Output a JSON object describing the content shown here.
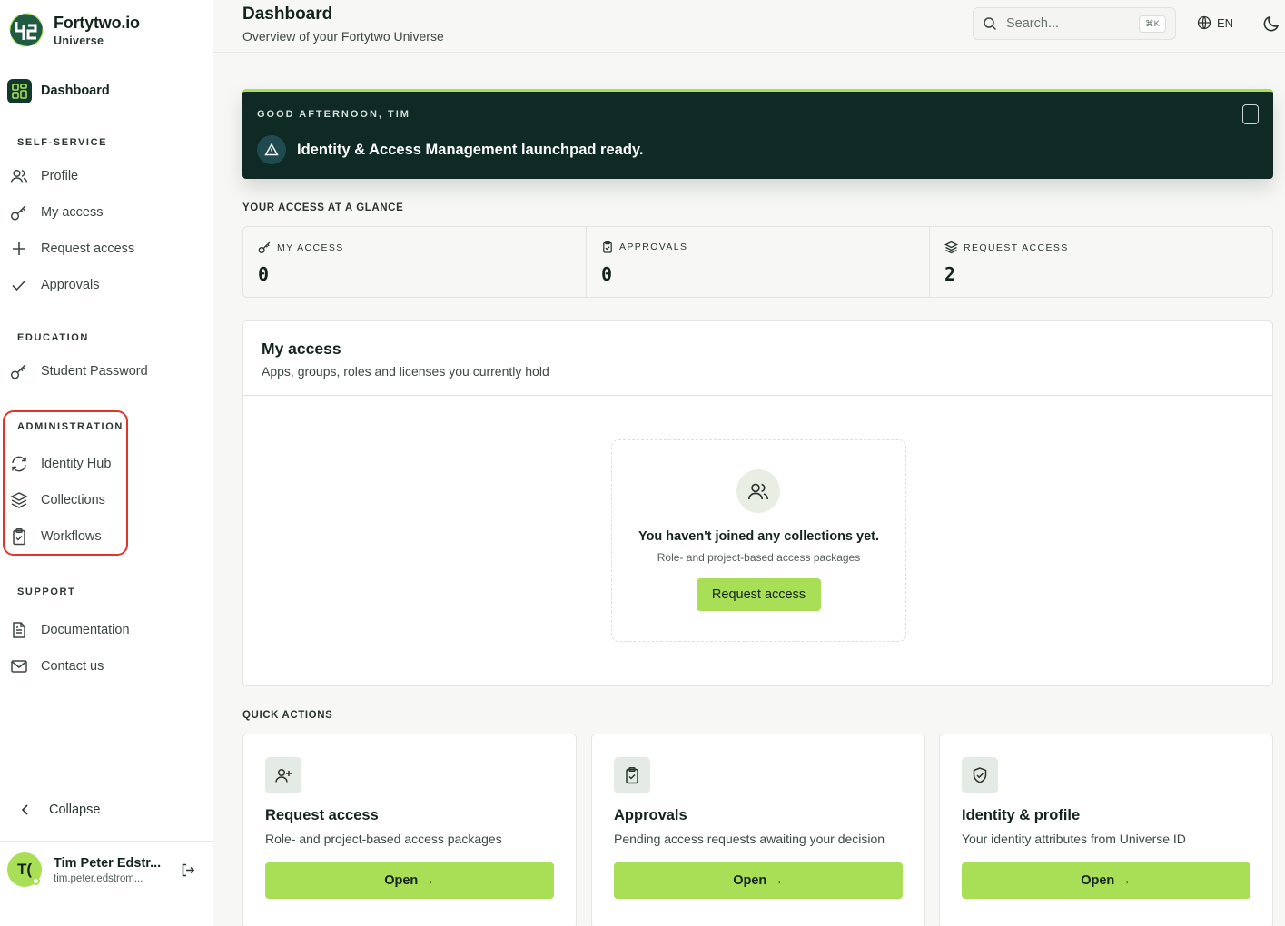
{
  "brand": {
    "name": "Fortytwo.io",
    "subtitle": "Universe"
  },
  "sidebar": {
    "dashboard_label": "Dashboard",
    "sections": [
      {
        "label": "SELF-SERVICE",
        "items": [
          {
            "label": "Profile",
            "icon": "users-icon"
          },
          {
            "label": "My access",
            "icon": "key-icon"
          },
          {
            "label": "Request access",
            "icon": "plus-icon"
          },
          {
            "label": "Approvals",
            "icon": "check-icon"
          }
        ]
      },
      {
        "label": "EDUCATION",
        "items": [
          {
            "label": "Student Password",
            "icon": "key-icon"
          }
        ]
      },
      {
        "label": "ADMINISTRATION",
        "items": [
          {
            "label": "Identity Hub",
            "icon": "refresh-icon"
          },
          {
            "label": "Collections",
            "icon": "layers-icon"
          },
          {
            "label": "Workflows",
            "icon": "clipboard-check-icon"
          }
        ]
      },
      {
        "label": "SUPPORT",
        "items": [
          {
            "label": "Documentation",
            "icon": "document-icon"
          },
          {
            "label": "Contact us",
            "icon": "mail-icon"
          }
        ]
      }
    ],
    "collapse_label": "Collapse",
    "user": {
      "initials": "T(",
      "name": "Tim Peter Edstr...",
      "email": "tim.peter.edstrom..."
    }
  },
  "header": {
    "title": "Dashboard",
    "subtitle": "Overview of your Fortytwo Universe",
    "search_placeholder": "Search...",
    "search_shortcut": "⌘K",
    "language": "EN"
  },
  "banner": {
    "greeting": "GOOD AFTERNOON, TIM",
    "message": "Identity & Access Management launchpad ready."
  },
  "glance": {
    "label": "YOUR ACCESS AT A GLANCE",
    "stats": [
      {
        "label": "MY ACCESS",
        "value": "0",
        "icon": "key-icon"
      },
      {
        "label": "APPROVALS",
        "value": "0",
        "icon": "clipboard-check-icon"
      },
      {
        "label": "REQUEST ACCESS",
        "value": "2",
        "icon": "layers-icon"
      }
    ]
  },
  "my_access": {
    "title": "My access",
    "subtitle": "Apps, groups, roles and licenses you currently hold",
    "empty_title": "You haven't joined any collections yet.",
    "empty_subtitle": "Role- and project-based access packages",
    "empty_button": "Request access"
  },
  "quick_actions": {
    "label": "QUICK ACTIONS",
    "cards": [
      {
        "title": "Request access",
        "description": "Role- and project-based access packages",
        "button": "Open →",
        "icon": "user-plus-icon"
      },
      {
        "title": "Approvals",
        "description": "Pending access requests awaiting your decision",
        "button": "Open →",
        "icon": "clipboard-check-icon"
      },
      {
        "title": "Identity & profile",
        "description": "Your identity attributes from Universe ID",
        "button": "Open →",
        "icon": "shield-check-icon"
      }
    ]
  },
  "colors": {
    "accent": "#a8df56",
    "banner_bg": "#0f2a25",
    "highlight": "#e0352b"
  }
}
